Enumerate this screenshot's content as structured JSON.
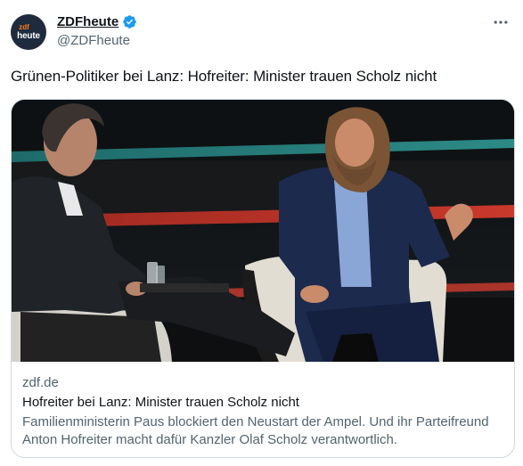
{
  "account": {
    "display_name": "ZDFheute",
    "handle": "@ZDFheute",
    "avatar_top": "zdf",
    "avatar_bottom": "heute",
    "verified_color": "#1d9bf0"
  },
  "tweet": {
    "text": "Grünen-Politiker bei Lanz: Hofreiter: Minister trauen Scholz nicht"
  },
  "card": {
    "domain": "zdf.de",
    "title": "Hofreiter bei Lanz: Minister trauen Scholz nicht",
    "description": "Familienministerin Paus blockiert den Neustart der Ampel. Und ihr Parteifreund Anton Hofreiter macht dafür Kanzler Olaf Scholz verantwortlich."
  },
  "icons": {
    "verified": "verified-badge-icon",
    "more": "more-options-icon"
  },
  "colors": {
    "text_primary": "#0f1419",
    "text_secondary": "#536471",
    "border": "#cfd9de",
    "brand_accent": "#ff7a1a"
  }
}
